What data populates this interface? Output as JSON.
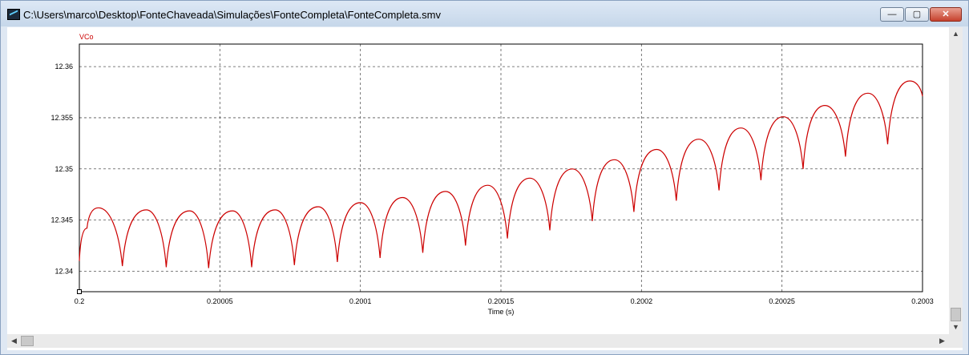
{
  "window": {
    "title": "C:\\Users\\marco\\Desktop\\FonteChaveada\\Simulações\\FonteCompleta\\FonteCompleta.smv",
    "buttons": {
      "minimize": "—",
      "maximize": "▢",
      "close": "✕"
    }
  },
  "chart_data": {
    "type": "line",
    "title": "",
    "xlabel": "Time (s)",
    "ylabel": "",
    "xlim": [
      0.2,
      0.2003
    ],
    "ylim": [
      12.338,
      12.3622
    ],
    "xticks": [
      0.2,
      0.20005,
      0.2001,
      0.20015,
      0.2002,
      0.20025,
      0.2003
    ],
    "xtick_labels": [
      "0.2",
      "0.20005",
      "0.2001",
      "0.20015",
      "0.2002",
      "0.20025",
      "0.2003"
    ],
    "yticks": [
      12.34,
      12.345,
      12.35,
      12.355,
      12.36
    ],
    "ytick_labels": [
      "12.34",
      "12.345",
      "12.35",
      "12.355",
      "12.36"
    ],
    "grid": true,
    "series": [
      {
        "name": "VCo",
        "color": "#cc0000",
        "x": [
          0.2,
          0.2000027,
          0.2000068,
          0.2000153,
          0.2000238,
          0.2000309,
          0.2000392,
          0.200046,
          0.2000545,
          0.2000613,
          0.2000697,
          0.2000765,
          0.200085,
          0.2000918,
          0.2001,
          0.200107,
          0.200115,
          0.2001222,
          0.2001303,
          0.2001374,
          0.2001453,
          0.2001523,
          0.2001603,
          0.2001674,
          0.2001754,
          0.2001825,
          0.2001904,
          0.2001973,
          0.2002054,
          0.2002124,
          0.2002204,
          0.2002276,
          0.2002354,
          0.2002425,
          0.2002505,
          0.2002575,
          0.2002653,
          0.2002726,
          0.2002806,
          0.2002876,
          0.2002955,
          0.2003
        ],
        "y": [
          12.341,
          12.3442,
          12.3462,
          12.3405,
          12.346,
          12.3404,
          12.3459,
          12.3403,
          12.3459,
          12.3404,
          12.346,
          12.3406,
          12.3463,
          12.3409,
          12.3467,
          12.3413,
          12.3472,
          12.3418,
          12.3478,
          12.3425,
          12.3484,
          12.3432,
          12.3491,
          12.344,
          12.35,
          12.3449,
          12.3509,
          12.3458,
          12.3519,
          12.3469,
          12.3529,
          12.3479,
          12.354,
          12.3489,
          12.3551,
          12.35,
          12.3562,
          12.3512,
          12.3574,
          12.3524,
          12.3586,
          12.3571
        ]
      }
    ]
  }
}
